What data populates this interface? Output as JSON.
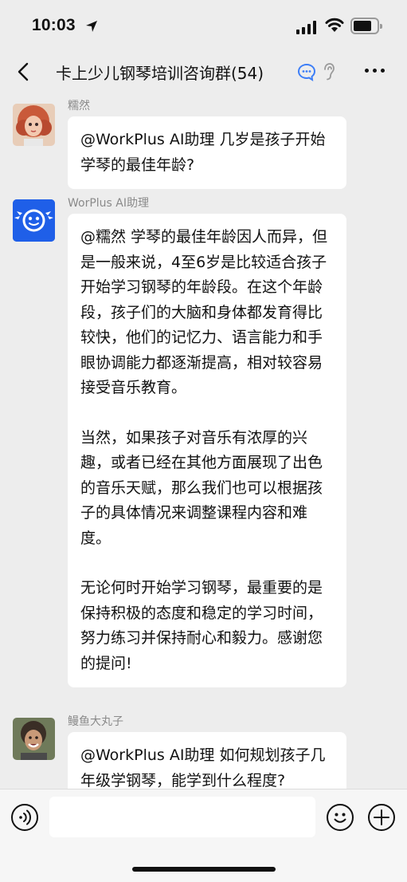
{
  "status_bar": {
    "time": "10:03"
  },
  "nav": {
    "title": "卡上少儿钢琴培训咨询群(54)"
  },
  "messages": [
    {
      "sender": "糯然",
      "paragraphs": [
        "@WorkPlus AI助理 几岁是孩子开始学琴的最佳年龄?"
      ]
    },
    {
      "sender": "WorPlus AI助理",
      "paragraphs": [
        "@糯然 学琴的最佳年龄因人而异，但是一般来说，4至6岁是比较适合孩子开始学习钢琴的年龄段。在这个年龄段，孩子们的大脑和身体都发育得比较快，他们的记忆力、语言能力和手眼协调能力都逐渐提高，相对较容易接受音乐教育。",
        "当然，如果孩子对音乐有浓厚的兴趣，或者已经在其他方面展现了出色的音乐天赋，那么我们也可以根据孩子的具体情况来调整课程内容和难度。",
        "无论何时开始学习钢琴，最重要的是保持积极的态度和稳定的学习时间，努力练习并保持耐心和毅力。感谢您的提问!"
      ]
    },
    {
      "sender": "鳗鱼大丸子",
      "paragraphs": [
        "@WorkPlus AI助理 如何规划孩子几年级学钢琴，能学到什么程度?"
      ]
    }
  ],
  "icons": {
    "back": "chevron-left-icon",
    "chat_status": "chat-bubble-icon",
    "mute": "ear-icon",
    "more": "more-dots-icon",
    "voice": "voice-icon",
    "emoji": "emoji-icon",
    "plus": "plus-icon"
  },
  "colors": {
    "background": "#ededed",
    "bubble": "#ffffff",
    "bot_avatar": "#1f5fe8",
    "accent_blue": "#3d7ef7",
    "sender_name": "#8a8a8a"
  }
}
